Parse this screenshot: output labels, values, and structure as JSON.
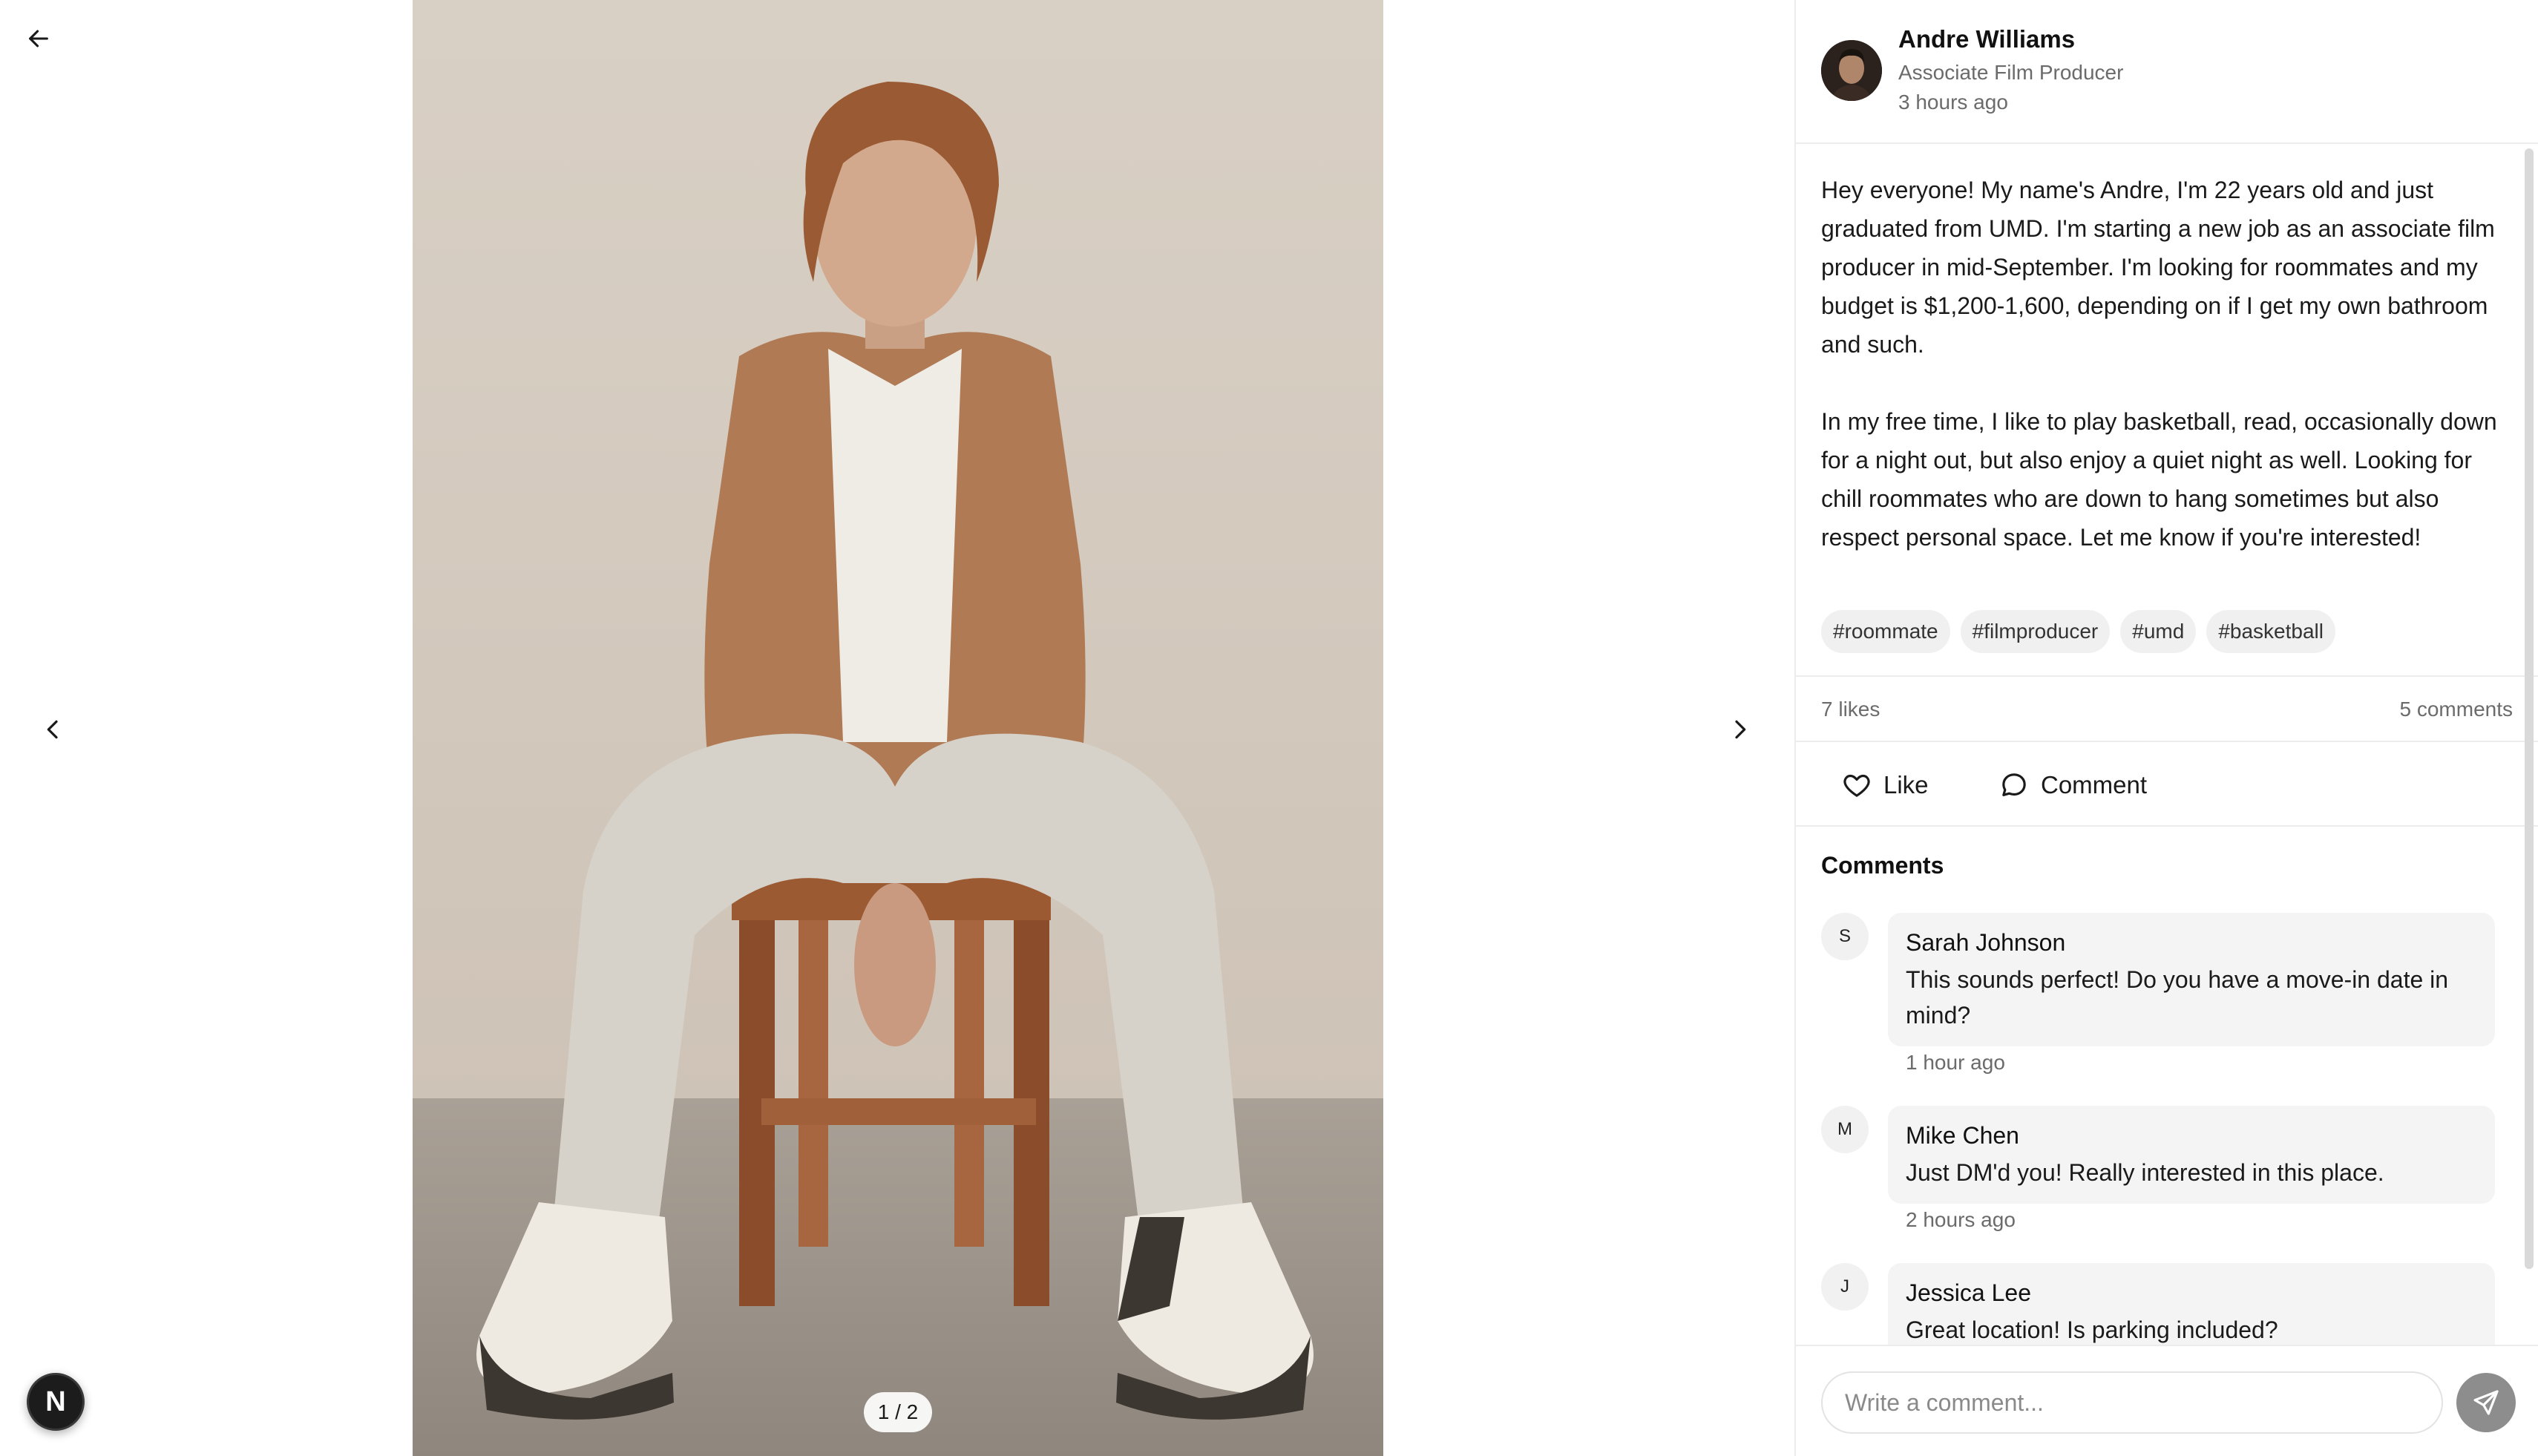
{
  "viewer": {
    "back_icon": "arrow-left-icon",
    "prev_icon": "chevron-left-icon",
    "next_icon": "chevron-right-icon",
    "photo_counter": "1 / 2",
    "badge_letter": "N"
  },
  "post": {
    "author": {
      "name": "Andre Williams",
      "role": "Associate Film Producer",
      "posted": "3 hours ago"
    },
    "body": {
      "p1": "Hey everyone! My name's Andre, I'm 22 years old and just graduated from UMD. I'm starting a new job as an associate film producer in mid-September. I'm looking for roommates and my budget is $1,200-1,600, depending on if I get my own bathroom and such.",
      "p2": "In my free time, I like to play basketball, read, occasionally down for a night out, but also enjoy a quiet night as well. Looking for chill roommates who are down to hang sometimes but also respect personal space. Let me know if you're interested!"
    },
    "tags": [
      "#roommate",
      "#filmproducer",
      "#umd",
      "#basketball"
    ],
    "stats": {
      "likes": "7 likes",
      "comments": "5 comments"
    },
    "actions": {
      "like_label": "Like",
      "like_icon": "heart-icon",
      "comment_label": "Comment",
      "comment_icon": "speech-bubble-icon"
    }
  },
  "comments_section": {
    "title": "Comments",
    "items": [
      {
        "initial": "S",
        "author": "Sarah Johnson",
        "text": "This sounds perfect! Do you have a move-in date in mind?",
        "time": "1 hour ago"
      },
      {
        "initial": "M",
        "author": "Mike Chen",
        "text": "Just DM'd you! Really interested in this place.",
        "time": "2 hours ago"
      },
      {
        "initial": "J",
        "author": "Jessica Lee",
        "text": "Great location! Is parking included?",
        "time": ""
      }
    ]
  },
  "composer": {
    "placeholder": "Write a comment...",
    "send_icon": "send-icon"
  },
  "colors": {
    "divider": "#ececec",
    "muted_text": "#6b6b6b",
    "tag_bg": "#f0f0f0",
    "comment_bg": "#f4f4f4",
    "send_button": "#8d8d8d"
  }
}
